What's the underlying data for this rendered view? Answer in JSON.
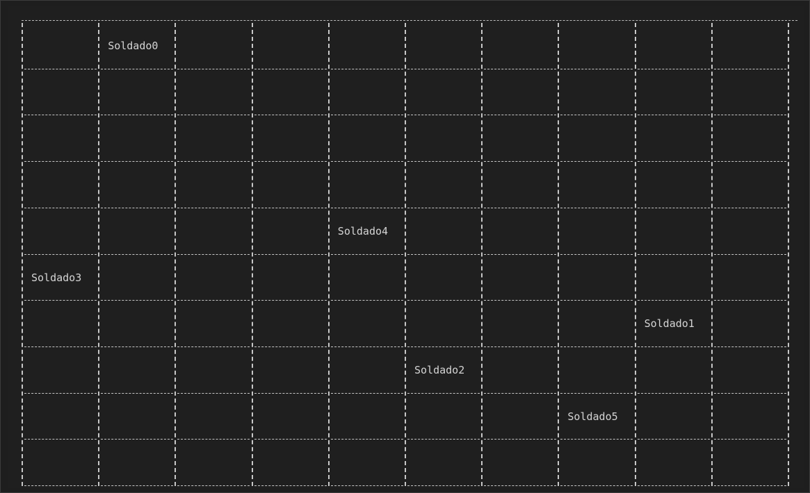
{
  "terminal": {
    "background": "#1f1f1f",
    "line_color": "#c8c8c8",
    "text_color": "#d4d4d4"
  },
  "board": {
    "rows": 10,
    "cols": 10,
    "soldiers": [
      {
        "label": "Soldado0",
        "row": 0,
        "col": 1
      },
      {
        "label": "Soldado4",
        "row": 4,
        "col": 4
      },
      {
        "label": "Soldado3",
        "row": 5,
        "col": 0
      },
      {
        "label": "Soldado1",
        "row": 6,
        "col": 8
      },
      {
        "label": "Soldado2",
        "row": 7,
        "col": 5
      },
      {
        "label": "Soldado5",
        "row": 8,
        "col": 7
      }
    ]
  }
}
